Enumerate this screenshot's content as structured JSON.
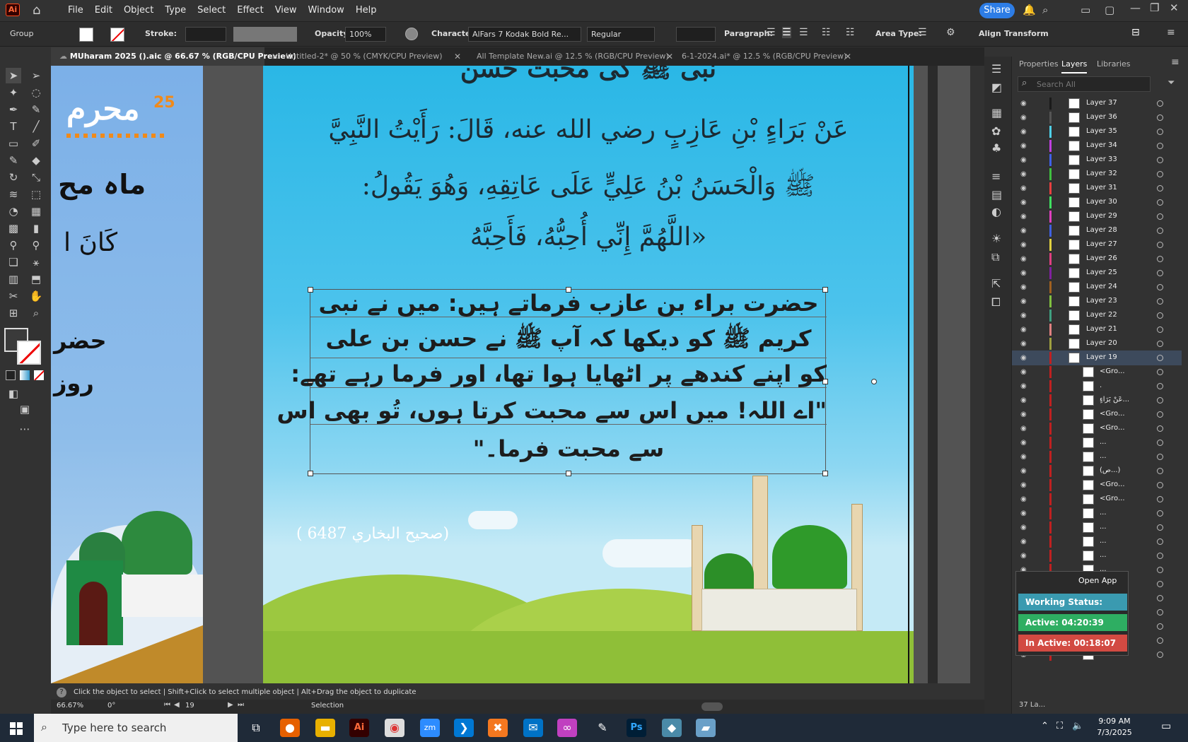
{
  "menubar": {
    "logo": "Ai",
    "items": [
      "File",
      "Edit",
      "Object",
      "Type",
      "Select",
      "Effect",
      "View",
      "Window",
      "Help"
    ],
    "share": "Share"
  },
  "control": {
    "selection_type": "Group",
    "stroke_label": "Stroke:",
    "opacity_label": "Opacity:",
    "opacity_value": "100%",
    "character_label": "Character:",
    "font_name": "AlFars 7 Kodak Bold Re...",
    "font_style": "Regular",
    "paragraph_label": "Paragraph:",
    "area_type_label": "Area Type:",
    "align_label": "Align",
    "transform_label": "Transform"
  },
  "tabs": [
    {
      "label": "MUharam 2025 ().aic @ 66.67 % (RGB/CPU Preview)"
    },
    {
      "label": "Untitled-2* @ 50 % (CMYK/CPU Preview)"
    },
    {
      "label": "All Template New.ai @ 12.5 % (RGB/CPU Preview)"
    },
    {
      "label": "6-1-2024.ai* @ 12.5 % (RGB/CPU Preview)"
    }
  ],
  "artwork": {
    "left_badge_number": "25",
    "left_title": "محرم",
    "left_line1": "ماہ مح",
    "left_line2": "كَانَ ا",
    "left_line3": "حضر",
    "left_line4": "روز",
    "top_partial": "نبی ﷺ کی محبت حسن",
    "arabic_line1": "عَنْ بَرَاءٍ بْنِ عَازِبٍ رضي الله عنه، قَالَ: رَأَيْتُ النَّبِيَّ",
    "arabic_line2": "ﷺ وَالْحَسَنُ بْنُ عَلِيٍّ عَلَى عَاتِقِهِ، وَهُوَ يَقُولُ:",
    "arabic_line3": "«اللَّهُمَّ إِنِّي أُحِبُّهُ، فَأَحِبَّهُ",
    "urdu_line1": "حضرت براء بن عازب فرماتے ہیں: میں نے نبی",
    "urdu_line2": "کریم ﷺ کو دیکھا کہ آپ ﷺ نے حسن بن علی",
    "urdu_line3": "کو اپنے کندھے پر اٹھایا ہوا تھا، اور فرما رہے تھے:",
    "urdu_line4": "\"اے اللہ! میں اس سے محبت کرتا ہوں، تُو بھی اس",
    "urdu_line5": "سے محبت فرما۔\"",
    "reference": "(صحيح البخاري 6487 )"
  },
  "panel": {
    "tabs": [
      "Properties",
      "Layers",
      "Libraries"
    ],
    "search_placeholder": "Search All",
    "layers": [
      {
        "name": "Layer 37",
        "color": "#1a1a1a"
      },
      {
        "name": "Layer 36",
        "color": "#555555"
      },
      {
        "name": "Layer 35",
        "color": "#4fd0e8"
      },
      {
        "name": "Layer 34",
        "color": "#c040e0"
      },
      {
        "name": "Layer 33",
        "color": "#4060e8"
      },
      {
        "name": "Layer 32",
        "color": "#40c040"
      },
      {
        "name": "Layer 31",
        "color": "#e84040"
      },
      {
        "name": "Layer 30",
        "color": "#40e060"
      },
      {
        "name": "Layer 29",
        "color": "#e040c0"
      },
      {
        "name": "Layer 28",
        "color": "#4060e0"
      },
      {
        "name": "Layer 27",
        "color": "#e0d040"
      },
      {
        "name": "Layer 26",
        "color": "#e04080"
      },
      {
        "name": "Layer 25",
        "color": "#8020a0"
      },
      {
        "name": "Layer 24",
        "color": "#a06020"
      },
      {
        "name": "Layer 23",
        "color": "#80c040"
      },
      {
        "name": "Layer 22",
        "color": "#40a080"
      },
      {
        "name": "Layer 21",
        "color": "#e08080"
      },
      {
        "name": "Layer 20",
        "color": "#a0a040"
      },
      {
        "name": "Layer 19",
        "color": "#c02020"
      }
    ],
    "sublayers": [
      "<Gro...",
      ".",
      "عَنْ بَرَاءٍ...",
      "<Gro...",
      "<Gro...",
      "...",
      "...",
      "(ص...)",
      "<Gro...",
      "<Gro...",
      "...",
      "...",
      "...",
      "...",
      "...",
      "...",
      "...",
      "...",
      "...",
      "...",
      "..."
    ],
    "layer_count": "37 La..."
  },
  "widget": {
    "open_app": "Open App",
    "working": "Working Status: Active",
    "active": "Active: 04:20:39",
    "inactive": "In Active: 00:18:07"
  },
  "status": {
    "hint": "Click the object to select  |  Shift+Click to select multiple object  |  Alt+Drag the object to duplicate",
    "zoom": "66.67%",
    "rotation": "0°",
    "artboard": "19",
    "tool": "Selection"
  },
  "taskbar": {
    "search": "Type here to search",
    "time": "9:09 AM",
    "date": "7/3/2025"
  }
}
